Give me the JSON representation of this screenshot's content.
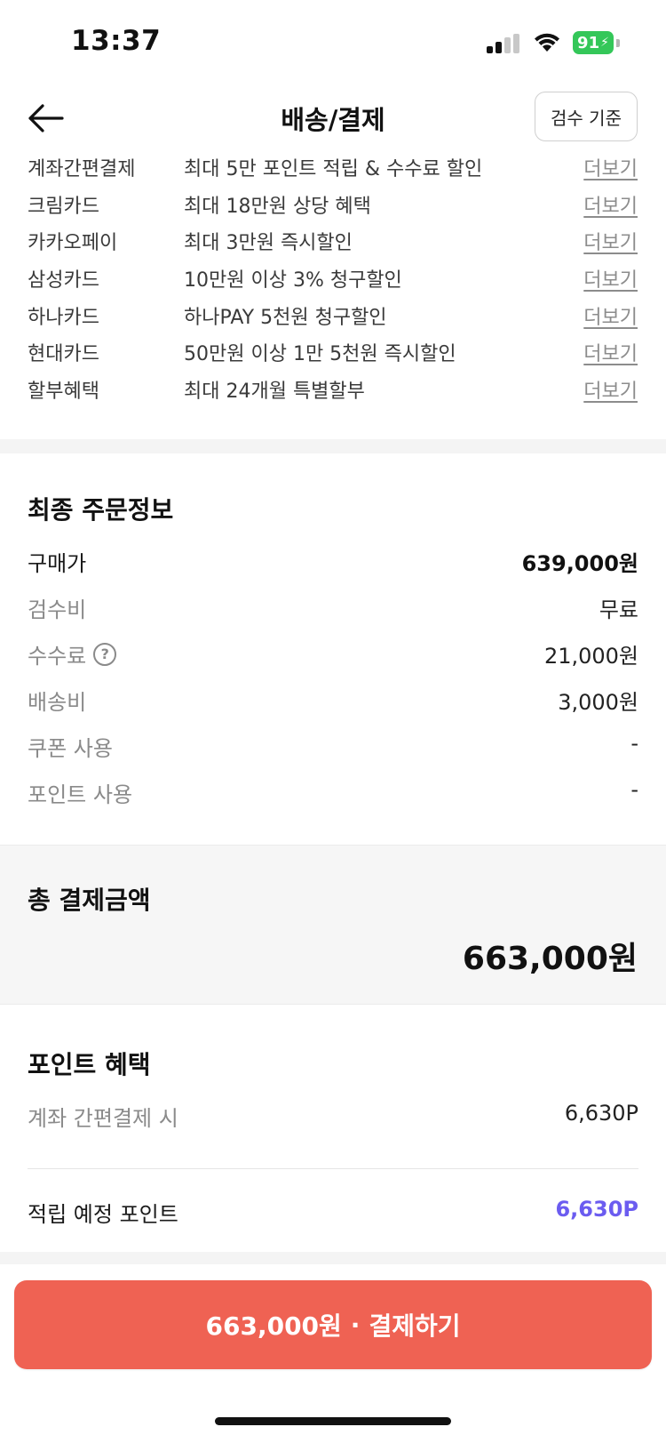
{
  "status_bar": {
    "time": "13:37",
    "battery": "91",
    "icons": [
      "signal-icon",
      "wifi-icon",
      "battery-icon"
    ]
  },
  "header": {
    "back_icon": "arrow-left-icon",
    "title": "배송/결제",
    "inspect_button": "검수 기준"
  },
  "benefits": [
    {
      "name": "계좌간편결제",
      "desc": "최대 5만 포인트 적립 & 수수료 할인",
      "more": "더보기"
    },
    {
      "name": "크림카드",
      "desc": "최대 18만원 상당 혜택",
      "more": "더보기"
    },
    {
      "name": "카카오페이",
      "desc": "최대 3만원 즉시할인",
      "more": "더보기"
    },
    {
      "name": "삼성카드",
      "desc": "10만원 이상 3% 청구할인",
      "more": "더보기"
    },
    {
      "name": "하나카드",
      "desc": "하나PAY 5천원 청구할인",
      "more": "더보기"
    },
    {
      "name": "현대카드",
      "desc": "50만원 이상 1만 5천원 즉시할인",
      "more": "더보기"
    },
    {
      "name": "할부혜택",
      "desc": "최대 24개월 특별할부",
      "more": "더보기"
    }
  ],
  "order_info": {
    "title": "최종 주문정보",
    "rows": [
      {
        "label": "구매가",
        "value": "639,000원"
      },
      {
        "label": "검수비",
        "value": "무료"
      },
      {
        "label": "수수료",
        "value": "21,000원",
        "help_icon": "question-circle-icon",
        "help_glyph": "?"
      },
      {
        "label": "배송비",
        "value": "3,000원"
      },
      {
        "label": "쿠폰 사용",
        "value": "-"
      },
      {
        "label": "포인트 사용",
        "value": "-"
      }
    ]
  },
  "total": {
    "label": "총 결제금액",
    "amount": "663,000원"
  },
  "points": {
    "title": "포인트 혜택",
    "rows": [
      {
        "label": "계좌 간편결제 시",
        "value": "6,630P"
      }
    ],
    "expected_label": "적립 예정 포인트",
    "expected_value": "6,630P"
  },
  "pay_button": {
    "amount": "663,000원",
    "separator": "·",
    "label": "결제하기"
  },
  "colors": {
    "pay_button": "#ef6253",
    "points_accent": "#6b5cf0",
    "battery": "#34c759"
  }
}
